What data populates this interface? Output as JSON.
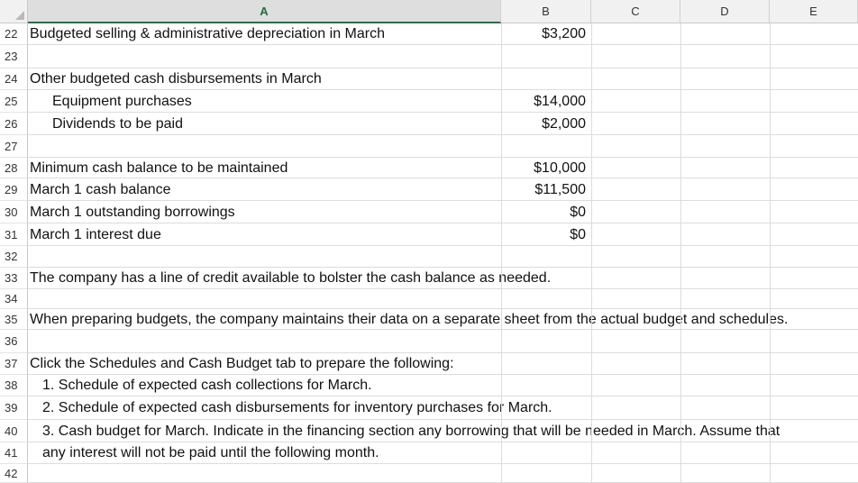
{
  "columns": [
    "A",
    "B",
    "C",
    "D",
    "E"
  ],
  "rows": [
    {
      "num": "22",
      "text": "Budgeted selling & administrative depreciation in March",
      "value": "$3,200"
    },
    {
      "num": "23",
      "text": "",
      "value": ""
    },
    {
      "num": "24",
      "text": "Other budgeted cash disbursements in March",
      "value": ""
    },
    {
      "num": "25",
      "text": "Equipment purchases",
      "value": "$14,000"
    },
    {
      "num": "26",
      "text": "Dividends to be paid",
      "value": "$2,000"
    },
    {
      "num": "27",
      "text": "",
      "value": ""
    },
    {
      "num": "28",
      "text": "Minimum cash balance to be maintained",
      "value": "$10,000"
    },
    {
      "num": "29",
      "text": "March 1 cash balance",
      "value": "$11,500"
    },
    {
      "num": "30",
      "text": "March 1 outstanding borrowings",
      "value": "$0"
    },
    {
      "num": "31",
      "text": "March 1 interest due",
      "value": "$0"
    },
    {
      "num": "32",
      "text": "",
      "value": ""
    },
    {
      "num": "33",
      "text": "The company has a line of credit available to bolster the cash balance as needed.",
      "value": ""
    },
    {
      "num": "34",
      "text": "",
      "value": ""
    },
    {
      "num": "35",
      "text": "When preparing budgets, the company maintains their data on a separate sheet from the actual budget and schedules.",
      "value": ""
    },
    {
      "num": "36",
      "text": "",
      "value": ""
    },
    {
      "num": "37",
      "text": "Click the Schedules and Cash Budget tab to prepare the following:",
      "value": ""
    },
    {
      "num": "38",
      "text": "1. Schedule of expected cash collections for March.",
      "value": ""
    },
    {
      "num": "39",
      "text": "2. Schedule of expected cash disbursements for inventory purchases for March.",
      "value": ""
    },
    {
      "num": "40",
      "text": "3. Cash budget for March. Indicate in the financing section any borrowing that will be needed in March.  Assume that",
      "value": ""
    },
    {
      "num": "41",
      "text": "any interest will not be paid until the following month.",
      "value": ""
    },
    {
      "num": "42",
      "text": "",
      "value": ""
    }
  ]
}
